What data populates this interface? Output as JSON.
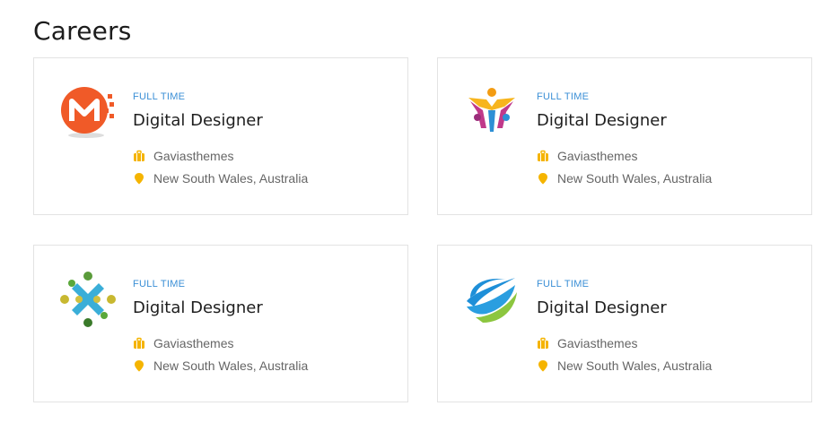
{
  "section": {
    "title": "Careers"
  },
  "colors": {
    "accent_blue": "#3b8fd6",
    "icon_yellow": "#f5b400"
  },
  "jobs": [
    {
      "logo_icon": "orange-m-logo-icon",
      "type": "FULL TIME",
      "title": "Digital Designer",
      "company": "Gaviasthemes",
      "location": "New South Wales, Australia"
    },
    {
      "logo_icon": "colorful-people-logo-icon",
      "type": "FULL TIME",
      "title": "Digital Designer",
      "company": "Gaviasthemes",
      "location": "New South Wales, Australia"
    },
    {
      "logo_icon": "green-blue-cross-logo-icon",
      "type": "FULL TIME",
      "title": "Digital Designer",
      "company": "Gaviasthemes",
      "location": "New South Wales, Australia"
    },
    {
      "logo_icon": "blue-green-swoosh-logo-icon",
      "type": "FULL TIME",
      "title": "Digital Designer",
      "company": "Gaviasthemes",
      "location": "New South Wales, Australia"
    }
  ]
}
